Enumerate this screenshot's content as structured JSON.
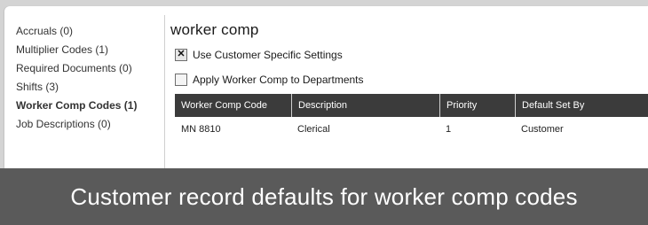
{
  "sidebar": {
    "items": [
      {
        "label": "Accruals (0)",
        "active": false
      },
      {
        "label": "Multiplier Codes (1)",
        "active": false
      },
      {
        "label": "Required Documents (0)",
        "active": false
      },
      {
        "label": "Shifts (3)",
        "active": false
      },
      {
        "label": "Worker Comp Codes (1)",
        "active": true
      },
      {
        "label": "Job Descriptions (0)",
        "active": false
      }
    ]
  },
  "main": {
    "title": "worker comp",
    "options": [
      {
        "label": "Use Customer Specific Settings",
        "checked": true
      },
      {
        "label": "Apply Worker Comp to Departments",
        "checked": false
      }
    ],
    "table": {
      "columns": [
        "Worker Comp Code",
        "Description",
        "Priority",
        "Default Set By"
      ],
      "rows": [
        [
          "MN 8810",
          "Clerical",
          "1",
          "Customer"
        ]
      ]
    }
  },
  "caption": "Customer record defaults for worker comp codes",
  "colors": {
    "background": "#d4d4d4",
    "panel": "#ffffff",
    "table_header": "#3b3b3b",
    "caption_bar": "#5a5a5a"
  }
}
